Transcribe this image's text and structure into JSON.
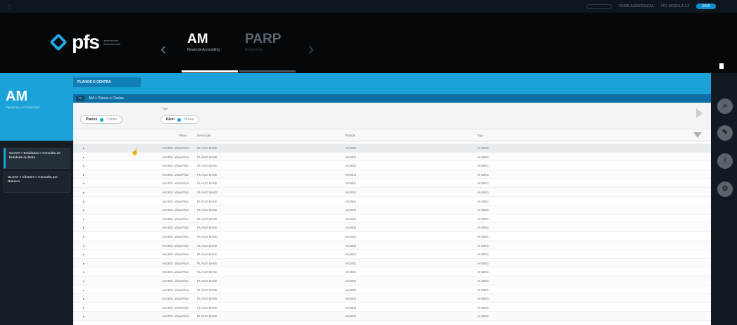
{
  "topbar": {
    "right_link_1": "PEDIR ASSISTENCIA",
    "right_link_2": "PDF MOZILLA 2.0",
    "pill": "SAIR"
  },
  "brand": {
    "name": "pfs",
    "tagline": "assessment financial suite"
  },
  "modules": [
    {
      "code": "AM",
      "subtitle": "Financial Accounting"
    },
    {
      "code": "PARP",
      "subtitle": "Economics"
    }
  ],
  "left_panel": {
    "code": "AM",
    "subtitle": "FINANCIAL ACCOUNTING",
    "items": [
      {
        "label": "GLOAT > Entidades > Consulta de Entidade ou Nota"
      },
      {
        "label": "GLOAT > Clientes > Consulta por Número"
      }
    ]
  },
  "section_tab": "PLANOS E CENTRA",
  "breadcrumb": {
    "toggle": "‹›",
    "text": "AM > Planos e Contas"
  },
  "filters": {
    "label": "Tipo",
    "group1": {
      "label": "Planos",
      "option": "Centro"
    },
    "group2": {
      "label": "Nível",
      "option": "Virtual"
    }
  },
  "columns": [
    "Plano",
    "Descrição",
    "Partida",
    "Tipo"
  ],
  "rows": [
    {
      "plano": "AH2801 urbanPlan",
      "descricao": "PLANO BAKE",
      "partida": "AH2801",
      "tipo": "AH2801"
    },
    {
      "plano": "AH2801 urbanPlan",
      "descricao": "PLANO BAKE",
      "partida": "AH2801",
      "tipo": "AH2801"
    },
    {
      "plano": "AH2801 urbanPlan",
      "descricao": "PLANO BAKE",
      "partida": "AH2801",
      "tipo": "AH2801"
    },
    {
      "plano": "AH2801 urbanPlan",
      "descricao": "PLANO BAKE",
      "partida": "AH2801",
      "tipo": "AH2801"
    },
    {
      "plano": "AH2801 urbanPlan",
      "descricao": "PLANO BAKE",
      "partida": "AH2801",
      "tipo": "AH2801"
    },
    {
      "plano": "AH2801 urbanPlan",
      "descricao": "PLANO BAKE",
      "partida": "AH2801",
      "tipo": "AH2801"
    },
    {
      "plano": "AH2801 urbanPlan",
      "descricao": "PLANO BAKE",
      "partida": "AH2801",
      "tipo": "AH2801"
    },
    {
      "plano": "AH2801 urbanPlan",
      "descricao": "PLANO BAKE",
      "partida": "AH2801",
      "tipo": "AH2801"
    },
    {
      "plano": "AH2801 urbanPlan",
      "descricao": "PLANO BAKE",
      "partida": "AH2801",
      "tipo": "AH2801"
    },
    {
      "plano": "AH2801 urbanPlan",
      "descricao": "PLANO BAKE",
      "partida": "AH2801",
      "tipo": "AH2801"
    },
    {
      "plano": "AH2801 urbanPlan",
      "descricao": "PLANO BAKE",
      "partida": "AH2801",
      "tipo": "AH2801"
    },
    {
      "plano": "AH2801 urbanPlan",
      "descricao": "PLANO BAKE",
      "partida": "AH2801",
      "tipo": "AH2801"
    },
    {
      "plano": "AH2801 urbanPlan",
      "descricao": "PLANO BAKE",
      "partida": "AH2801",
      "tipo": "AH2801"
    },
    {
      "plano": "AH2801 urbanPlan",
      "descricao": "PLANO BAKE",
      "partida": "AH2801",
      "tipo": "AH2801"
    },
    {
      "plano": "AH2801 urbanPlan",
      "descricao": "PLANO BAKE",
      "partida": "AH2801",
      "tipo": "AH2801"
    },
    {
      "plano": "AH2801 urbanPlan",
      "descricao": "PLANO BAKE",
      "partida": "AH2801",
      "tipo": "AH2801"
    },
    {
      "plano": "AH2801 urbanPlan",
      "descricao": "PLANO BAKE",
      "partida": "AH2801",
      "tipo": "AH2801"
    },
    {
      "plano": "AH2801 urbanPlan",
      "descricao": "PLANO BAKE",
      "partida": "AH2801",
      "tipo": "AH2801"
    },
    {
      "plano": "AH2801 urbanPlan",
      "descricao": "PLANO BAKE",
      "partida": "AH2801",
      "tipo": "AH2801"
    },
    {
      "plano": "AH2801 urbanPlan",
      "descricao": "PLANO BAKE",
      "partida": "AH2801",
      "tipo": "AH2801"
    }
  ],
  "rail_icons": [
    "search-icon",
    "edit-icon",
    "info-icon",
    "settings-icon"
  ],
  "colors": {
    "accent": "#1ba2d8",
    "header": "#05080b"
  }
}
